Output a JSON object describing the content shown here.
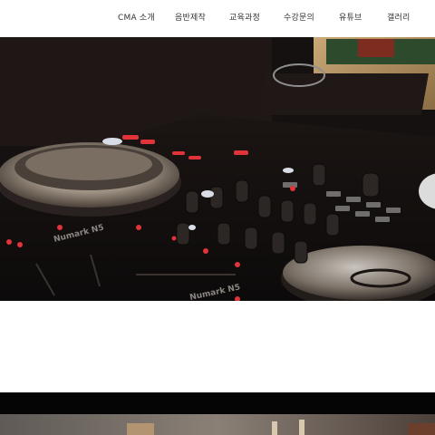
{
  "nav": {
    "items": [
      {
        "label": "CMA 소개"
      },
      {
        "label": "음반제작"
      },
      {
        "label": "교육과정"
      },
      {
        "label": "수강문의"
      },
      {
        "label": "유튜브"
      },
      {
        "label": "갤러리"
      }
    ]
  },
  "hero": {
    "controller_brand": "Numark N5",
    "controller_brand_2": "Numark N5"
  },
  "colors": {
    "nav_text": "#333333",
    "hero_bg": "#141010",
    "led_red": "#e0333a",
    "dark_band": "#050505"
  }
}
